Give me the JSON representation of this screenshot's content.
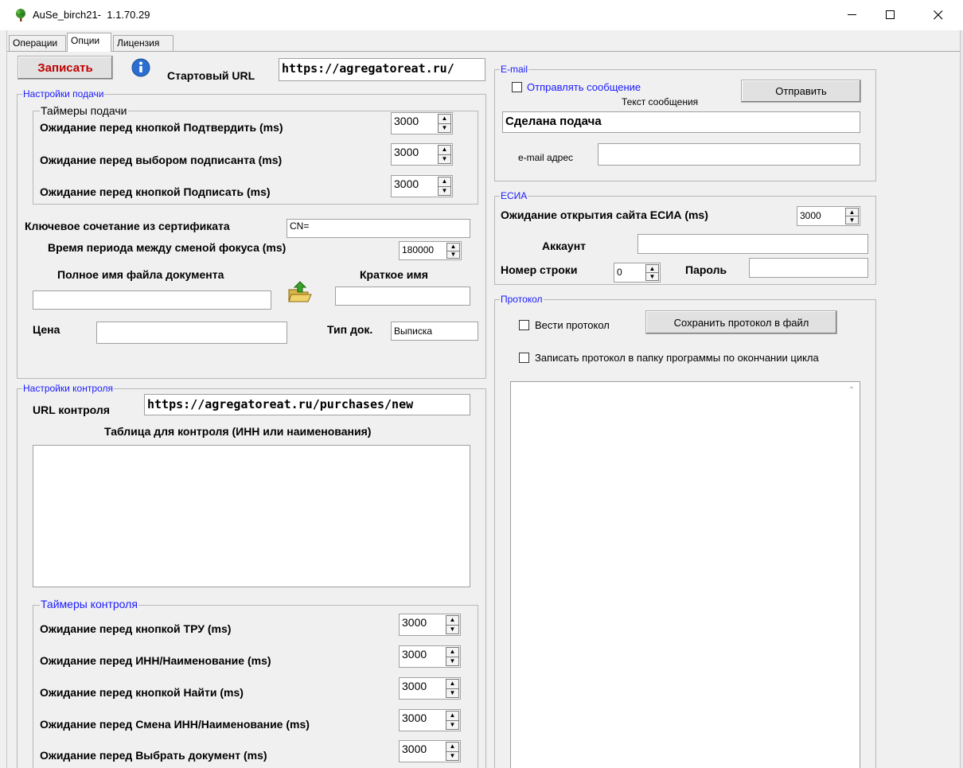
{
  "window": {
    "title": "AuSe_birch21-  1.1.70.29",
    "icon": "tree-icon",
    "minimize": "—",
    "maximize": "☐",
    "close": "✕"
  },
  "tabs": [
    {
      "label": "Операции"
    },
    {
      "label": "Опции"
    },
    {
      "label": "Лицензия"
    }
  ],
  "top": {
    "save_label": "Записать",
    "save_color": "#c00000",
    "start_url_label": "Стартовый URL",
    "start_url_value": "https://agregatoreat.ru/"
  },
  "submit_settings": {
    "title": "Настройки подачи",
    "timers_title": "Таймеры подачи",
    "timers": [
      {
        "label": "Ожидание перед кнопкой Подтвердить (ms)",
        "value": "3000"
      },
      {
        "label": "Ожидание перед выбором подписанта (ms)",
        "value": "3000"
      },
      {
        "label": "Ожидание перед кнопкой Подписать (ms)",
        "value": "3000"
      }
    ],
    "cert_key_label": "Ключевое сочетание из  сертификата",
    "cert_key_value": "CN=",
    "focus_period_label": "Время периода между сменой фокуса (ms)",
    "focus_period_value": "180000",
    "doc_file_label": "Полное имя файла документа",
    "doc_file_value": "",
    "short_name_label": "Краткое имя",
    "short_name_value": "",
    "price_label": "Цена",
    "price_value": "",
    "doc_type_label": "Тип док.",
    "doc_type_value": "Выписка"
  },
  "control_settings": {
    "title": "Настройки контроля",
    "url_label": "URL контроля",
    "url_value": "https://agregatoreat.ru/purchases/new",
    "table_label": "Таблица для контроля (ИНН или наименования)",
    "timers_title": "Таймеры контроля",
    "timers": [
      {
        "label": "Ожидание перед кнопкой ТРУ (ms)",
        "value": "3000"
      },
      {
        "label": "Ожидание перед ИНН/Наименование (ms)",
        "value": "3000"
      },
      {
        "label": "Ожидание перед кнопкой Найти (ms)",
        "value": "3000"
      },
      {
        "label": "Ожидание перед Смена ИНН/Наименование (ms)",
        "value": "3000"
      },
      {
        "label": "Ожидание перед Выбрать документ (ms)",
        "value": "3000"
      }
    ]
  },
  "email": {
    "title": "E-mail",
    "send_checkbox_label": "Отправлять сообщение",
    "send_button": "Отправить",
    "message_text_label": "Текст сообщения",
    "message_text_value": "Сделана подача",
    "address_label": "e-mail адрес",
    "address_value": ""
  },
  "esia": {
    "title": "ЕСИА",
    "wait_label": "Ожидание открытия сайта ЕСИА (ms)",
    "wait_value": "3000",
    "account_label": "Аккаунт",
    "account_value": "",
    "row_label": "Номер строки",
    "row_value": "0",
    "password_label": "Пароль",
    "password_value": ""
  },
  "protocol": {
    "title": "Протокол",
    "keep_label": "Вести протокол",
    "save_button": "Сохранить протокол в файл",
    "write_label": "Записать протокол в папку программы по окончании цикла"
  }
}
